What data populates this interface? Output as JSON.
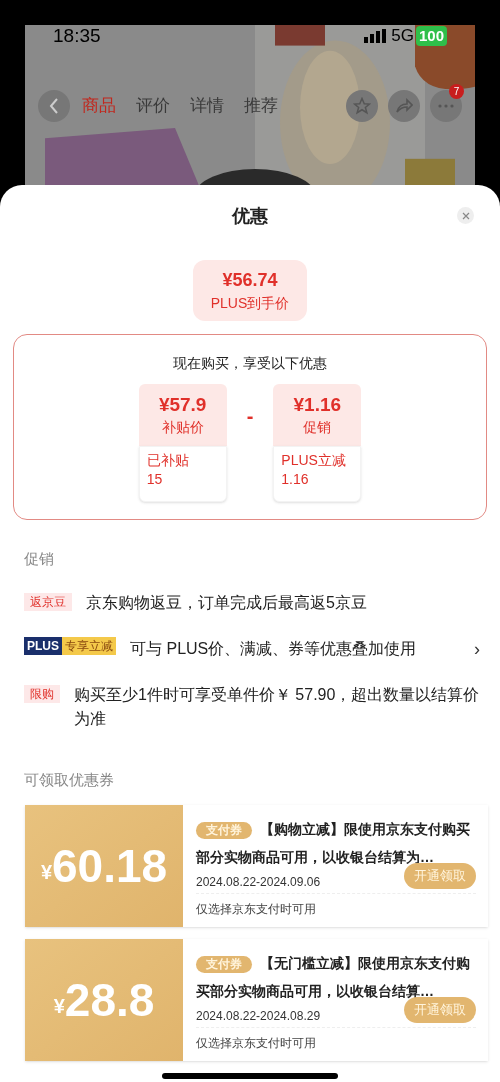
{
  "status_bar": {
    "time": "18:35",
    "network": "5G",
    "battery": "100"
  },
  "nav": {
    "tabs": [
      {
        "label": "商品",
        "selected": true
      },
      {
        "label": "评价",
        "selected": false
      },
      {
        "label": "详情",
        "selected": false
      },
      {
        "label": "推荐",
        "selected": false
      }
    ],
    "badge": "7"
  },
  "sheet": {
    "title": "优惠",
    "final_price": {
      "price": "¥56.74",
      "label": "PLUS到手价"
    },
    "breakdown": {
      "heading": "现在购买，享受以下优惠",
      "operator": "-",
      "items": [
        {
          "price": "¥57.9",
          "label": "补贴价",
          "detail": "已补贴\n15"
        },
        {
          "price": "¥1.16",
          "label": "促销",
          "detail": "PLUS立减\n1.16"
        }
      ]
    },
    "promotions": {
      "heading": "促销",
      "items": [
        {
          "kind": "tag",
          "tag": "返京豆",
          "text": "京东购物返豆，订单完成后最高返5京豆"
        },
        {
          "kind": "plus",
          "tag_left": "PLUS",
          "tag": "专享立减",
          "text": "可与 PLUS价、满减、券等优惠叠加使用",
          "arrow": "›"
        },
        {
          "kind": "tag",
          "tag": "限购",
          "text": "购买至少1件时可享受单件价￥ 57.90，超出数量以结算价为准"
        }
      ]
    },
    "coupons": {
      "heading": "可领取优惠券",
      "items": [
        {
          "currency": "¥",
          "amount": "60.18",
          "tag": "支付券",
          "title": "【购物立减】限使用京东支付购买部分实物商品可用，以收银台结算为…",
          "dates": "2024.08.22-2024.09.06",
          "button": "开通领取",
          "note": "仅选择京东支付时可用"
        },
        {
          "currency": "¥",
          "amount": "28.8",
          "tag": "支付券",
          "title": "【无门槛立减】限使用京东支付购买部分实物商品可用，以收银台结算…",
          "dates": "2024.08.22-2024.08.29",
          "button": "开通领取",
          "note": "仅选择京东支付时可用"
        }
      ]
    }
  }
}
